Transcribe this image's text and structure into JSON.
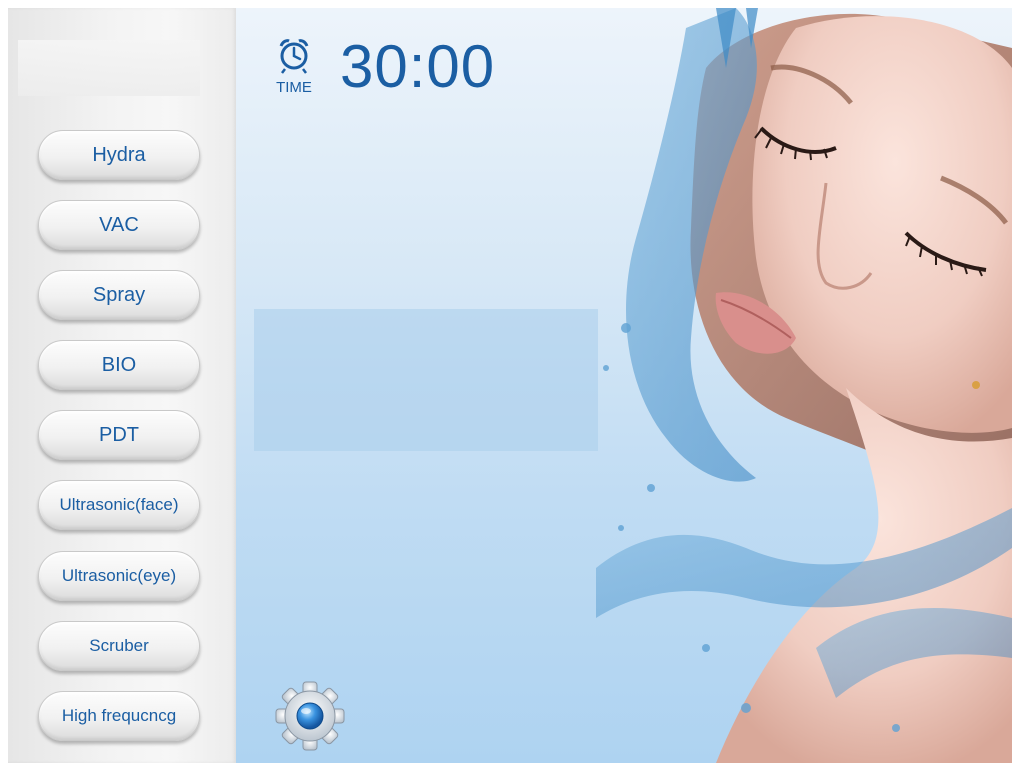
{
  "timer": {
    "label": "TIME",
    "value": "30:00"
  },
  "menu": [
    {
      "label": "Hydra"
    },
    {
      "label": "VAC"
    },
    {
      "label": "Spray"
    },
    {
      "label": "BIO"
    },
    {
      "label": "PDT"
    },
    {
      "label": "Ultrasonic(face)"
    },
    {
      "label": "Ultrasonic(eye)"
    },
    {
      "label": "Scruber"
    },
    {
      "label": "High frequcncg"
    }
  ],
  "colors": {
    "accent": "#1b5ea3",
    "sidebar": "#f2f2f2",
    "background": "#c0dcf3"
  },
  "icons": {
    "timer": "alarm-clock-icon",
    "settings": "gear-icon"
  }
}
